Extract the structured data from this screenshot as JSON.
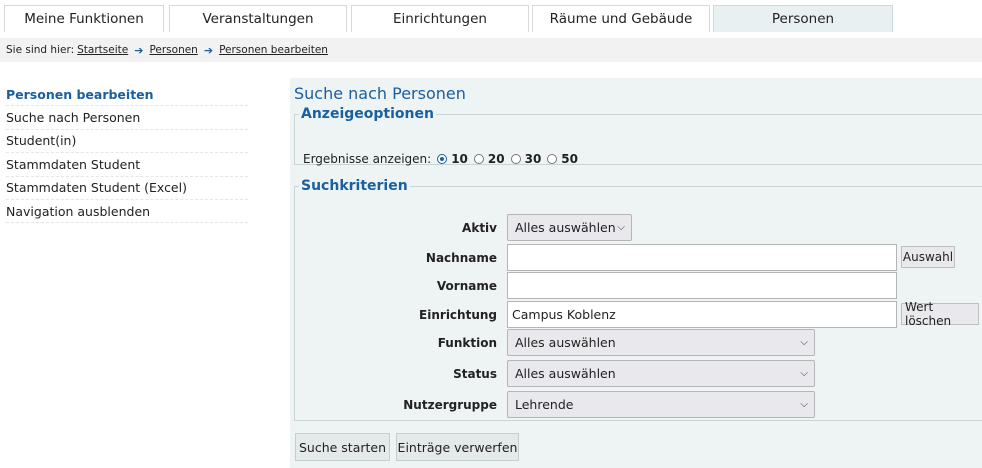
{
  "tabs": [
    {
      "label": "Meine Funktionen"
    },
    {
      "label": "Veranstaltungen"
    },
    {
      "label": "Einrichtungen"
    },
    {
      "label": "Räume und Gebäude"
    },
    {
      "label": "Personen",
      "active": true
    }
  ],
  "breadcrumb": {
    "lead": "Sie sind hier:",
    "items": [
      "Startseite",
      "Personen",
      "Personen bearbeiten"
    ]
  },
  "sidebar": {
    "items": [
      {
        "label": "Personen bearbeiten",
        "active": true
      },
      {
        "label": "Suche nach Personen"
      },
      {
        "label": "Student(in)"
      },
      {
        "label": "Stammdaten Student"
      },
      {
        "label": "Stammdaten Student (Excel)"
      },
      {
        "label": "Navigation ausblenden"
      }
    ]
  },
  "main": {
    "title": "Suche nach Personen",
    "anzeige": {
      "legend": "Anzeigeoptionen",
      "label": "Ergebnisse anzeigen:",
      "options": [
        "10",
        "20",
        "30",
        "50"
      ],
      "selected": "10"
    },
    "such": {
      "legend": "Suchkriterien",
      "aktiv": {
        "label": "Aktiv",
        "value": "Alles auswählen"
      },
      "nachname": {
        "label": "Nachname",
        "value": "",
        "button": "Auswahl"
      },
      "vorname": {
        "label": "Vorname",
        "value": ""
      },
      "einrichtung": {
        "label": "Einrichtung",
        "value": "Campus Koblenz",
        "button": "Wert löschen"
      },
      "funktion": {
        "label": "Funktion",
        "value": "Alles auswählen"
      },
      "status": {
        "label": "Status",
        "value": "Alles auswählen"
      },
      "nutzergruppe": {
        "label": "Nutzergruppe",
        "value": "Lehrende"
      }
    },
    "buttons": {
      "start": "Suche starten",
      "reset": "Einträge verwerfen"
    }
  },
  "colors": {
    "accent": "#1a5fa0",
    "panel": "#eef3f3",
    "active_tab": "#e9f0f1"
  }
}
